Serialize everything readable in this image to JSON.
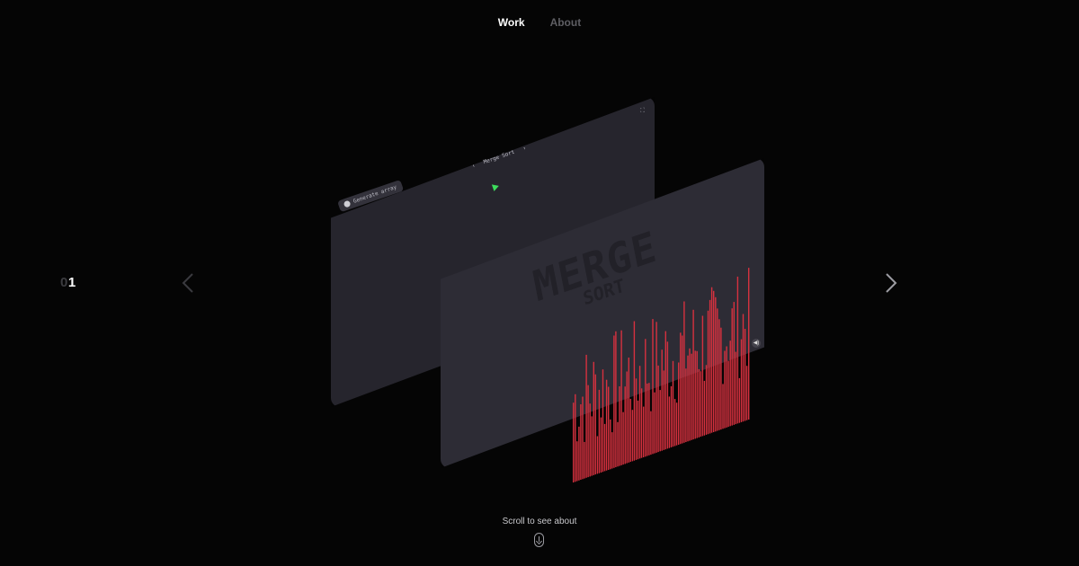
{
  "nav": {
    "work_label": "Work",
    "about_label": "About"
  },
  "counter": {
    "prefix": "0",
    "current": "1"
  },
  "preview": {
    "generate_label": "Generate array",
    "algorithm_name": "Merge Sort",
    "prev_algo_symbol": "‹",
    "next_algo_symbol": "›",
    "fullscreen_symbol": "⛶",
    "watermark_line1": "MERGE",
    "watermark_line2": "SORT",
    "sound_symbol": "◀)",
    "bar_color": "#d6313f",
    "play_color": "#3ddc5c"
  },
  "footer": {
    "scroll_label": "Scroll to see about"
  },
  "icons": {
    "prev": "chevron-left-icon",
    "next": "chevron-right-icon",
    "mouse": "mouse-scroll-icon"
  }
}
